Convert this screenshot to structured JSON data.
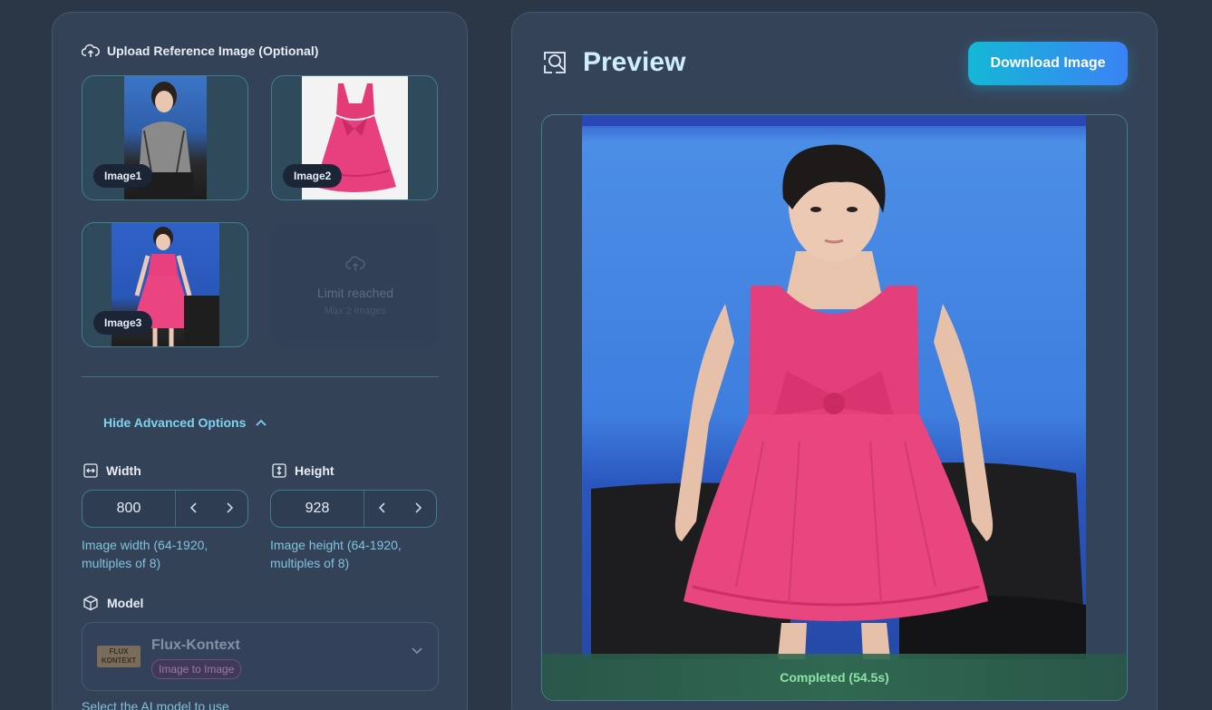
{
  "upload": {
    "title": "Upload Reference Image (Optional)",
    "images": [
      {
        "label": "Image1"
      },
      {
        "label": "Image2"
      },
      {
        "label": "Image3"
      }
    ],
    "limit_title": "Limit reached",
    "limit_subtitle": "Max 2 images"
  },
  "advanced": {
    "toggle_label": "Hide Advanced Options",
    "width": {
      "label": "Width",
      "value": "800",
      "help_line1": "Image width (64-1920,",
      "help_line2": "multiples of 8)"
    },
    "height": {
      "label": "Height",
      "value": "928",
      "help_line1": "Image height (64-1920,",
      "help_line2": "multiples of 8)"
    },
    "model": {
      "label": "Model",
      "logo_line1": "FLUX",
      "logo_line2": "KONTEXT",
      "name": "Flux-Kontext",
      "badge": "Image to Image",
      "help": "Select the AI model to use"
    }
  },
  "preview": {
    "title": "Preview",
    "download_label": "Download Image",
    "status": "Completed (54.5s)"
  },
  "colors": {
    "accent": "#7ed3ef",
    "status_green": "#8de3a5",
    "button_gradient_start": "#14b8d6",
    "button_gradient_end": "#3b82f6"
  },
  "icons": {
    "upload": "cloud-upload-icon",
    "chevron_up": "chevron-up-icon",
    "width": "arrows-horizontal-icon",
    "height": "arrows-vertical-icon",
    "model": "cube-icon",
    "preview": "search-image-icon",
    "select": "chevron-down-icon"
  }
}
